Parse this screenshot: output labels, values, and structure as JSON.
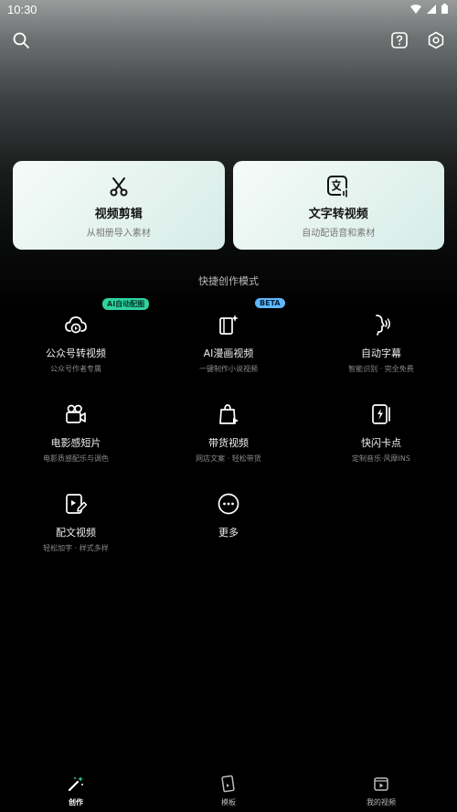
{
  "status_bar": {
    "time": "10:30"
  },
  "top_bar": {
    "icons": [
      "search-icon",
      "help-icon",
      "settings-icon"
    ]
  },
  "cards": [
    {
      "title": "视频剪辑",
      "subtitle": "从相册导入素材",
      "icon": "scissors-icon"
    },
    {
      "title": "文字转视频",
      "subtitle": "自动配语音和素材",
      "icon": "text-to-video-icon"
    }
  ],
  "quick_section": {
    "title": "快捷创作模式"
  },
  "tools": [
    {
      "title": "公众号转视频",
      "subtitle": "公众号作者专属",
      "badge": "AI自动配图"
    },
    {
      "title": "AI漫画视频",
      "subtitle": "一键制作小说视频",
      "badge": "BETA"
    },
    {
      "title": "自动字幕",
      "subtitle": "智能识别 · 完全免费",
      "badge": ""
    },
    {
      "title": "电影感短片",
      "subtitle": "电影质感配乐与调色",
      "badge": ""
    },
    {
      "title": "带货视频",
      "subtitle": "网店文案 · 轻松带货",
      "badge": ""
    },
    {
      "title": "快闪卡点",
      "subtitle": "定制音乐·风靡INS",
      "badge": ""
    },
    {
      "title": "配文视频",
      "subtitle": "轻松加字 · 样式多样",
      "badge": ""
    },
    {
      "title": "更多",
      "subtitle": "",
      "badge": ""
    }
  ],
  "tabs": [
    {
      "label": "创作",
      "active": true
    },
    {
      "label": "模板",
      "active": false
    },
    {
      "label": "我的视频",
      "active": false
    }
  ],
  "colors": {
    "accent_green": "#2fd3a0",
    "accent_blue": "#5fb8ff",
    "card_bg": "#e4f3ee"
  }
}
